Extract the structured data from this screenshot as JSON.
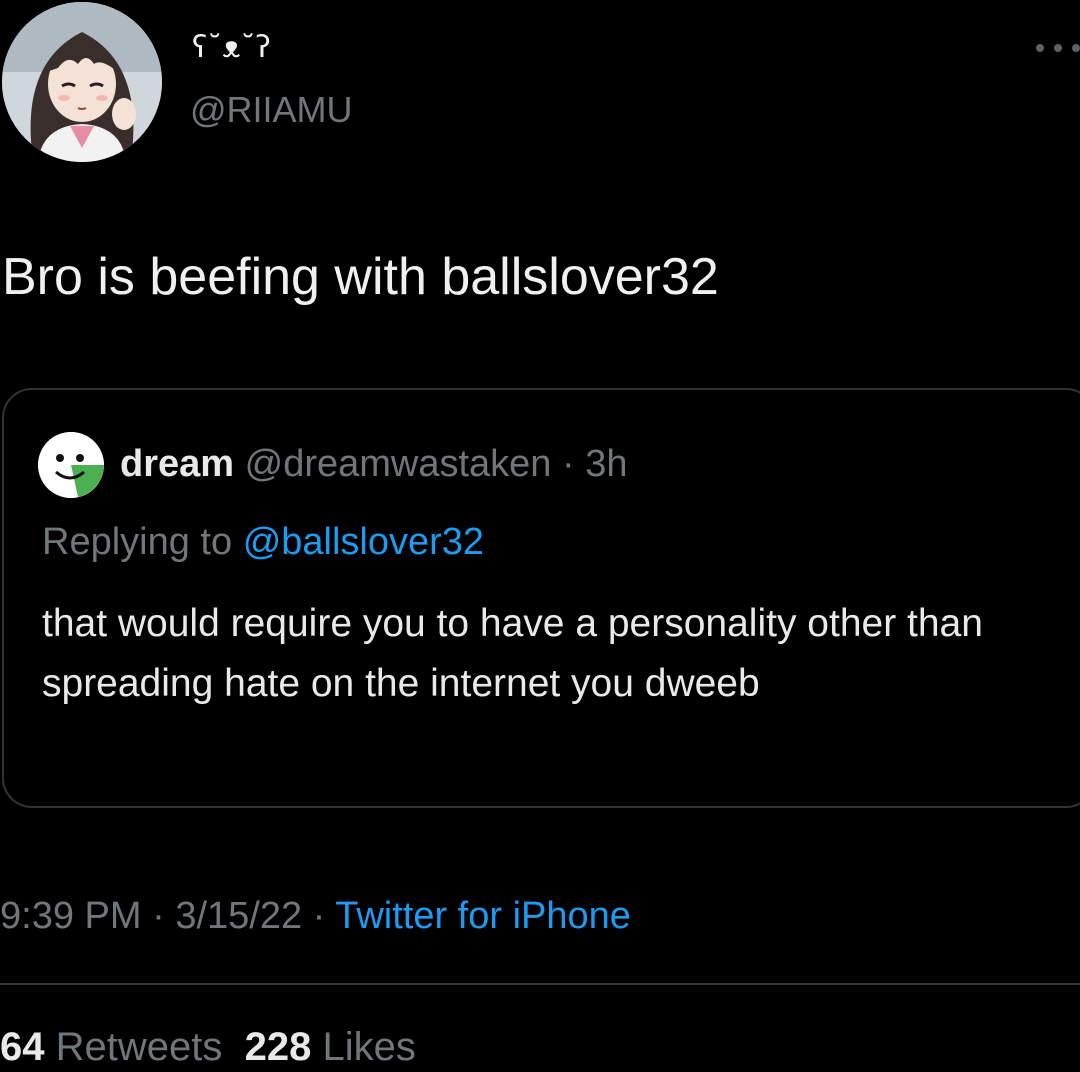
{
  "author": {
    "display_name": "ʕ˘ᴥ˘ʔ",
    "handle": "@RIIAMU",
    "avatar_icon": "anime-avatar"
  },
  "tweet": {
    "text": "Bro is beefing with ballslover32"
  },
  "quoted_tweet": {
    "name": "dream",
    "handle": "@dreamwastaken",
    "separator": "·",
    "time": "3h",
    "replying_label": "Replying to",
    "replying_to": "@ballslover32",
    "body": "that would require you to have a personality other than spreading hate on the internet you dweeb",
    "avatar_icon": "dream-mask-avatar"
  },
  "meta": {
    "time": "9:39 PM",
    "separator_1": " · ",
    "date": "3/15/22",
    "separator_2": " · ",
    "source": "Twitter for iPhone"
  },
  "stats": {
    "retweets_count": "64",
    "retweets_label": "Retweets",
    "likes_count": "228",
    "likes_label": "Likes"
  },
  "colors": {
    "background": "#000000",
    "text": "#e7e9ea",
    "secondary": "#71767b",
    "link": "#1d9bf0",
    "border": "#2f3336"
  }
}
